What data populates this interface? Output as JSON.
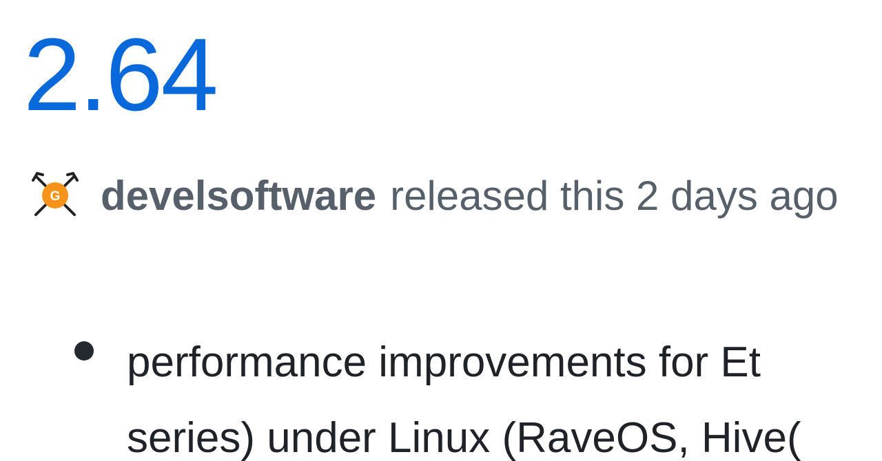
{
  "release": {
    "title": "2.64",
    "author": "develsoftware",
    "released_text": "released this 2 days ago",
    "avatar_letter": "G"
  },
  "notes": {
    "items": [
      {
        "line1": "performance improvements for Et",
        "line2": "series) under Linux (RaveOS, Hive("
      }
    ]
  },
  "colors": {
    "link": "#0969da",
    "muted": "#57606a",
    "text": "#1f2328",
    "avatar_orange": "#f7931a"
  }
}
